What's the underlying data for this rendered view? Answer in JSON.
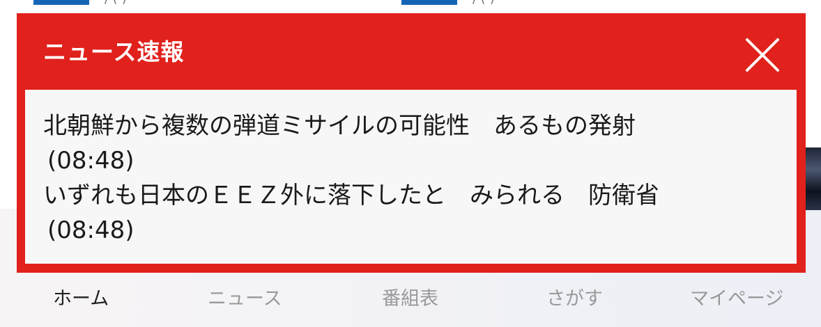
{
  "colors": {
    "popup_background": "#e1211c",
    "popup_body_background": "#f7f7f7",
    "nav_active": "#222222",
    "nav_inactive": "#999999",
    "top_tab_accent": "#1565b7"
  },
  "popup": {
    "title": "ニュース速報",
    "close_icon": "close-icon",
    "items": [
      {
        "headline": "北朝鮮から複数の弾道ミサイルの可能性　あるもの発射",
        "time": "(08:48)"
      },
      {
        "headline": "いずれも日本のＥＥＺ外に落下したと　みられる　防衛省",
        "time": "(08:48)"
      }
    ]
  },
  "top_partial": {
    "left_text": "/ (  )",
    "right_text": "/ (  )"
  },
  "bottom_nav": {
    "items": [
      {
        "label": "ホーム",
        "active": true
      },
      {
        "label": "ニュース",
        "active": false
      },
      {
        "label": "番組表",
        "active": false
      },
      {
        "label": "さがす",
        "active": false
      },
      {
        "label": "マイページ",
        "active": false
      }
    ]
  }
}
